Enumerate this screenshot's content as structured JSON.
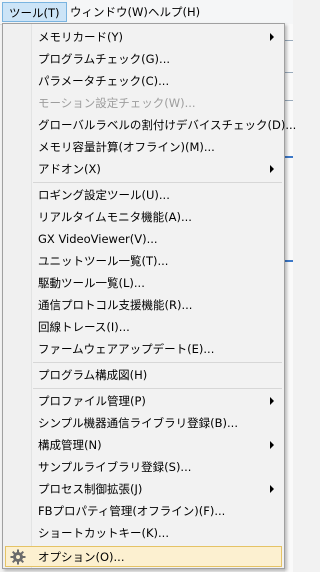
{
  "menubar": {
    "items": [
      {
        "label": "ツール(T)"
      },
      {
        "label": "ウィンドウ(W)"
      },
      {
        "label": "ヘルプ(H)"
      }
    ]
  },
  "menu": {
    "items": [
      {
        "label": "メモリカード(Y)",
        "submenu": true
      },
      {
        "label": "プログラムチェック(G)..."
      },
      {
        "label": "パラメータチェック(C)..."
      },
      {
        "label": "モーション設定チェック(W)...",
        "disabled": true
      },
      {
        "label": "グローバルラベルの割付けデバイスチェック(D)..."
      },
      {
        "label": "メモリ容量計算(オフライン)(M)..."
      },
      {
        "label": "アドオン(X)",
        "submenu": true
      },
      {
        "label": "ロギング設定ツール(U)..."
      },
      {
        "label": "リアルタイムモニタ機能(A)..."
      },
      {
        "label": "GX VideoViewer(V)..."
      },
      {
        "label": "ユニットツール一覧(T)..."
      },
      {
        "label": "駆動ツール一覧(L)..."
      },
      {
        "label": "通信プロトコル支援機能(R)..."
      },
      {
        "label": "回線トレース(I)..."
      },
      {
        "label": "ファームウェアアップデート(E)..."
      },
      {
        "label": "プログラム構成図(H)"
      },
      {
        "label": "プロファイル管理(P)",
        "submenu": true
      },
      {
        "label": "シンプル機器通信ライブラリ登録(B)..."
      },
      {
        "label": "構成管理(N)",
        "submenu": true
      },
      {
        "label": "サンプルライブラリ登録(S)..."
      },
      {
        "label": "プロセス制御拡張(J)",
        "submenu": true
      },
      {
        "label": "FBプロパティ管理(オフライン)(F)..."
      },
      {
        "label": "ショートカットキー(K)..."
      },
      {
        "label": "オプション(O)...",
        "icon": "gear-icon",
        "highlighted": true
      }
    ]
  }
}
